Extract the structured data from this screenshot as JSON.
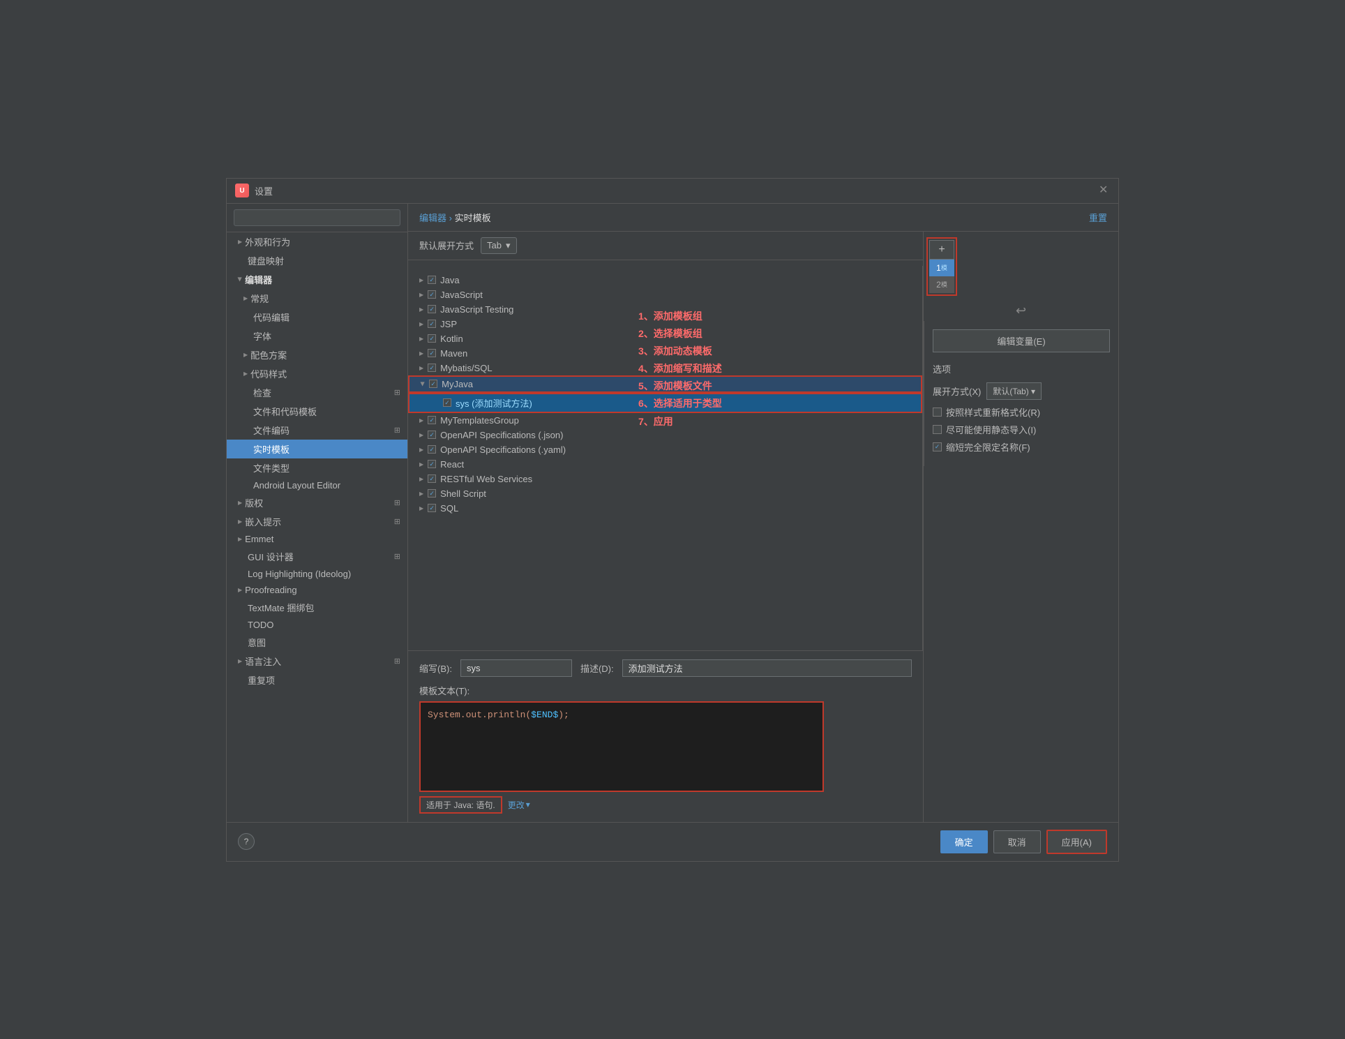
{
  "dialog": {
    "title": "设置",
    "close_label": "✕"
  },
  "search": {
    "placeholder": ""
  },
  "sidebar": {
    "items": [
      {
        "id": "appearance",
        "label": "外观和行为",
        "level": 0,
        "expandable": true,
        "expanded": false
      },
      {
        "id": "keymap",
        "label": "键盘映射",
        "level": 0,
        "expandable": false
      },
      {
        "id": "editor",
        "label": "编辑器",
        "level": 0,
        "expandable": true,
        "expanded": true
      },
      {
        "id": "general",
        "label": "常规",
        "level": 1,
        "expandable": true,
        "expanded": false
      },
      {
        "id": "code-editing",
        "label": "代码编辑",
        "level": 1,
        "expandable": false
      },
      {
        "id": "font",
        "label": "字体",
        "level": 1,
        "expandable": false
      },
      {
        "id": "color-scheme",
        "label": "配色方案",
        "level": 1,
        "expandable": true,
        "expanded": false
      },
      {
        "id": "code-style",
        "label": "代码样式",
        "level": 1,
        "expandable": true,
        "expanded": false
      },
      {
        "id": "inspection",
        "label": "检查",
        "level": 1,
        "expandable": false,
        "icon_right": true
      },
      {
        "id": "file-code-templates",
        "label": "文件和代码模板",
        "level": 1,
        "expandable": false
      },
      {
        "id": "file-encoding",
        "label": "文件编码",
        "level": 1,
        "expandable": false,
        "icon_right": true
      },
      {
        "id": "live-templates",
        "label": "实时模板",
        "level": 1,
        "expandable": false,
        "active": true
      },
      {
        "id": "file-types",
        "label": "文件类型",
        "level": 1,
        "expandable": false
      },
      {
        "id": "android-layout",
        "label": "Android Layout Editor",
        "level": 1,
        "expandable": false
      },
      {
        "id": "copyright",
        "label": "版权",
        "level": 0,
        "expandable": true,
        "expanded": false,
        "icon_right": true
      },
      {
        "id": "inlay-hints",
        "label": "嵌入提示",
        "level": 0,
        "expandable": true,
        "expanded": false,
        "icon_right": true
      },
      {
        "id": "emmet",
        "label": "Emmet",
        "level": 0,
        "expandable": true,
        "expanded": false
      },
      {
        "id": "gui-designer",
        "label": "GUI 设计器",
        "level": 0,
        "expandable": false,
        "icon_right": true
      },
      {
        "id": "log-highlighting",
        "label": "Log Highlighting (Ideolog)",
        "level": 0,
        "expandable": false
      },
      {
        "id": "proofreading",
        "label": "Proofreading",
        "level": 0,
        "expandable": true,
        "expanded": false
      },
      {
        "id": "textmate",
        "label": "TextMate 捆绑包",
        "level": 0,
        "expandable": false
      },
      {
        "id": "todo",
        "label": "TODO",
        "level": 0,
        "expandable": false
      },
      {
        "id": "intention",
        "label": "意图",
        "level": 0,
        "expandable": false
      },
      {
        "id": "lang-inject",
        "label": "语言注入",
        "level": 0,
        "expandable": true,
        "expanded": false,
        "icon_right": true
      },
      {
        "id": "reset-item",
        "label": "重复项",
        "level": 0,
        "expandable": false
      }
    ]
  },
  "main": {
    "breadcrumb_editor": "编辑器",
    "breadcrumb_sep": " › ",
    "breadcrumb_current": "实时模板",
    "reset_label": "重置",
    "default_expand_label": "默认展开方式",
    "default_expand_value": "Tab",
    "tree_items": [
      {
        "id": "java",
        "label": "Java",
        "checked": true,
        "expandable": true
      },
      {
        "id": "javascript",
        "label": "JavaScript",
        "checked": true,
        "expandable": true
      },
      {
        "id": "js-testing",
        "label": "JavaScript Testing",
        "checked": true,
        "expandable": true
      },
      {
        "id": "jsp",
        "label": "JSP",
        "checked": true,
        "expandable": true
      },
      {
        "id": "kotlin",
        "label": "Kotlin",
        "checked": true,
        "expandable": true
      },
      {
        "id": "maven",
        "label": "Maven",
        "checked": true,
        "expandable": true
      },
      {
        "id": "mybatis",
        "label": "Mybatis/SQL",
        "checked": true,
        "expandable": true
      },
      {
        "id": "myjava",
        "label": "MyJava",
        "checked": true,
        "expandable": true,
        "selected_group": true
      },
      {
        "id": "sys-sub",
        "label": "sys (添加测试方法)",
        "checked": true,
        "expandable": false,
        "sub": true,
        "selected": true
      },
      {
        "id": "mytemplates",
        "label": "MyTemplatesGroup",
        "checked": true,
        "expandable": true
      },
      {
        "id": "openapi-json",
        "label": "OpenAPI Specifications (.json)",
        "checked": true,
        "expandable": true
      },
      {
        "id": "openapi-yaml",
        "label": "OpenAPI Specifications (.yaml)",
        "checked": true,
        "expandable": true
      },
      {
        "id": "react",
        "label": "React",
        "checked": true,
        "expandable": true
      },
      {
        "id": "restful",
        "label": "RESTful Web Services",
        "checked": true,
        "expandable": true
      },
      {
        "id": "shell",
        "label": "Shell Script",
        "checked": true,
        "expandable": true
      },
      {
        "id": "sql",
        "label": "SQL",
        "checked": true,
        "expandable": true
      }
    ],
    "action_buttons": [
      {
        "id": "add",
        "label": "+"
      },
      {
        "id": "num1",
        "label": "1",
        "active": true
      },
      {
        "id": "num2",
        "label": "2",
        "active": false
      }
    ],
    "annotation": {
      "line1": "1、添加模板组",
      "line2": "2、选择模板组",
      "line3": "3、添加动态模板",
      "line4": "4、添加缩写和描述",
      "line5": "5、添加模板文件",
      "line6": "6、选择适用于类型",
      "line7": "7、应用"
    },
    "form": {
      "abbr_label": "缩写(B):",
      "abbr_value": "sys",
      "desc_label": "描述(D):",
      "desc_value": "添加测试方法",
      "template_label": "模板文本(T):",
      "template_code": "System.out.println($END$);",
      "applicable_label": "适用于 Java: 语句.",
      "change_label": "更改"
    },
    "settings": {
      "edit_vars_label": "编辑变量(E)",
      "options_label": "选项",
      "expand_label": "展开方式(X)",
      "expand_value": "默认(Tab)",
      "checkbox1_label": "按照样式重新格式化(R)",
      "checkbox1_checked": false,
      "checkbox2_label": "尽可能使用静态导入(I)",
      "checkbox2_checked": false,
      "checkbox3_label": "缩短完全限定名称(F)",
      "checkbox3_checked": true
    }
  },
  "footer": {
    "confirm_label": "确定",
    "cancel_label": "取消",
    "apply_label": "应用(A)",
    "help_label": "?"
  }
}
